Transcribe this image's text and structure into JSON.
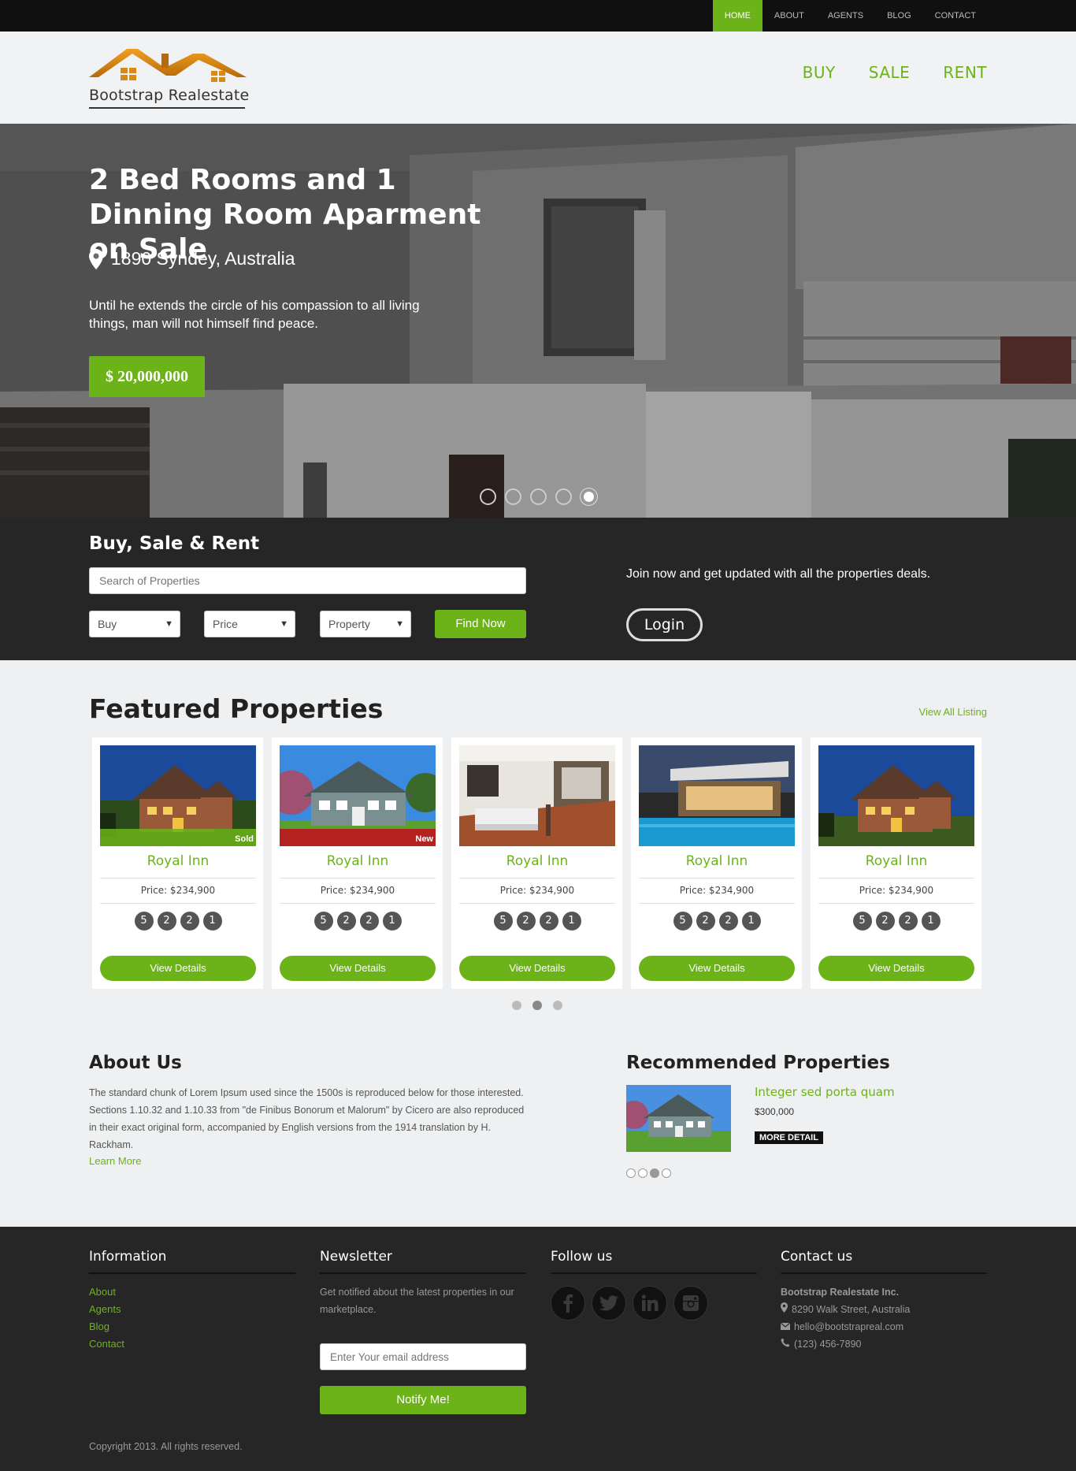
{
  "topnav": {
    "items": [
      {
        "label": "HOME"
      },
      {
        "label": "ABOUT"
      },
      {
        "label": "AGENTS"
      },
      {
        "label": "BLOG"
      },
      {
        "label": "CONTACT"
      }
    ]
  },
  "header": {
    "logo_text": "Bootstrap Realestate",
    "nav": [
      {
        "label": "BUY"
      },
      {
        "label": "SALE"
      },
      {
        "label": "RENT"
      }
    ]
  },
  "hero": {
    "title": "2 Bed Rooms and 1 Dinning Room Aparment on Sale",
    "location": "1890 Syndey, Australia",
    "description": "Until he extends the circle of his compassion to all living things, man will not himself find peace.",
    "price": "$ 20,000,000",
    "slide_count": 5,
    "active_slide": 5
  },
  "search": {
    "title": "Buy, Sale & Rent",
    "placeholder": "Search of Properties",
    "selects": [
      {
        "value": "Buy"
      },
      {
        "value": "Price"
      },
      {
        "value": "Property"
      }
    ],
    "find_label": "Find Now",
    "join_text": "Join now and get updated with all the properties deals.",
    "login_label": "Login"
  },
  "featured": {
    "title": "Featured Properties",
    "view_all": "View All Listing",
    "cards": [
      {
        "name": "Royal Inn",
        "price": "Price: $234,900",
        "stats": [
          "5",
          "2",
          "2",
          "1"
        ],
        "badge": "Sold",
        "button": "View Details"
      },
      {
        "name": "Royal Inn",
        "price": "Price: $234,900",
        "stats": [
          "5",
          "2",
          "2",
          "1"
        ],
        "badge": "New",
        "button": "View Details"
      },
      {
        "name": "Royal Inn",
        "price": "Price: $234,900",
        "stats": [
          "5",
          "2",
          "2",
          "1"
        ],
        "badge": "",
        "button": "View Details"
      },
      {
        "name": "Royal Inn",
        "price": "Price: $234,900",
        "stats": [
          "5",
          "2",
          "2",
          "1"
        ],
        "badge": "",
        "button": "View Details"
      },
      {
        "name": "Royal Inn",
        "price": "Price: $234,900",
        "stats": [
          "5",
          "2",
          "2",
          "1"
        ],
        "badge": "",
        "button": "View Details"
      }
    ],
    "page_count": 3,
    "active_page": 2
  },
  "about": {
    "title": "About Us",
    "text": "The standard chunk of Lorem Ipsum used since the 1500s is reproduced below for those interested. Sections 1.10.32 and 1.10.33 from \"de Finibus Bonorum et Malorum\" by Cicero are also reproduced in their exact original form, accompanied by English versions from the 1914 translation by H. Rackham.",
    "learn_more": "Learn More"
  },
  "recommended": {
    "title": "Recommended Properties",
    "name": "Integer sed porta quam",
    "price": "$300,000",
    "more_label": "MORE DETAIL",
    "page_count": 4,
    "active_page": 3
  },
  "footer": {
    "information": {
      "title": "Information",
      "links": [
        {
          "label": "About"
        },
        {
          "label": "Agents"
        },
        {
          "label": "Blog"
        },
        {
          "label": "Contact"
        }
      ]
    },
    "newsletter": {
      "title": "Newsletter",
      "text": "Get notified about the latest properties in our marketplace.",
      "placeholder": "Enter Your email address",
      "button": "Notify Me!"
    },
    "follow": {
      "title": "Follow us",
      "icons": [
        "facebook-icon",
        "twitter-icon",
        "linkedin-icon",
        "instagram-icon"
      ]
    },
    "contact": {
      "title": "Contact us",
      "company": "Bootstrap Realestate Inc.",
      "address": "8290 Walk Street, Australia",
      "email": "hello@bootstrapreal.com",
      "phone": "(123) 456-7890"
    },
    "copyright": "Copyright 2013. All rights reserved."
  },
  "colors": {
    "accent": "#6cb31a",
    "dark_band": "#262626",
    "topbar": "#101010",
    "page_bg": "#eef0f1"
  }
}
